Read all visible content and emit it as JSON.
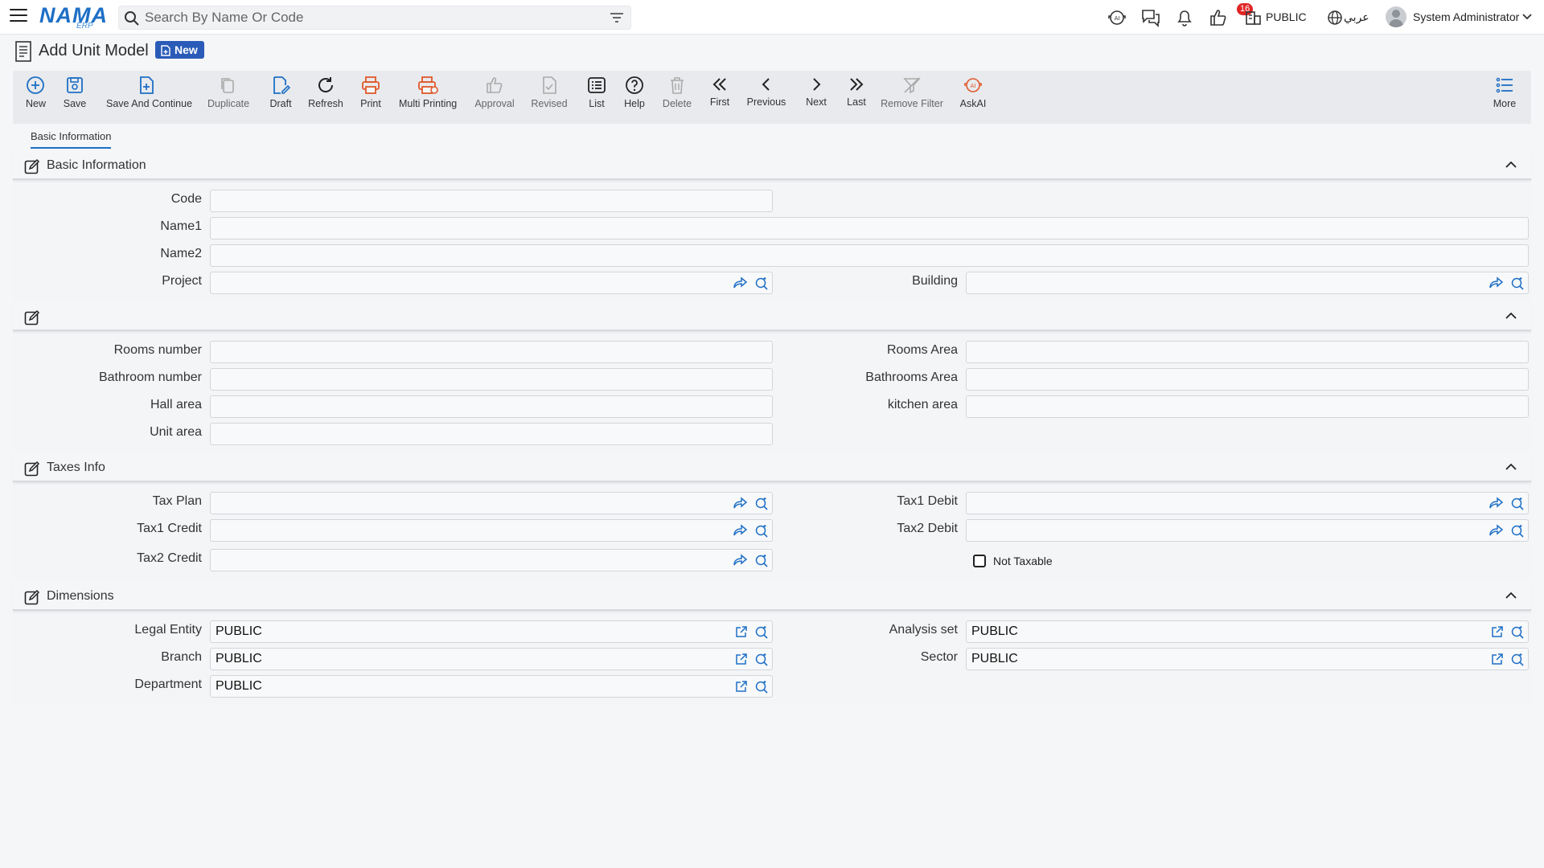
{
  "topbar": {
    "search_placeholder": "Search By Name Or Code",
    "logo_text": "NAMA",
    "logo_sub": "ERP",
    "notification_count": "16",
    "company": "PUBLIC",
    "language": "عربي",
    "user_name": "System Administrator"
  },
  "page": {
    "title": "Add Unit Model",
    "status_tag": "New"
  },
  "toolbar": {
    "new": "New",
    "save": "Save",
    "save_continue": "Save And Continue",
    "duplicate": "Duplicate",
    "draft": "Draft",
    "refresh": "Refresh",
    "print": "Print",
    "multi_printing": "Multi Printing",
    "approval": "Approval",
    "revised": "Revised",
    "list": "List",
    "help": "Help",
    "delete": "Delete",
    "first": "First",
    "previous": "Previous",
    "next": "Next",
    "last": "Last",
    "remove_filter": "Remove Filter",
    "askai": "AskAI",
    "more": "More"
  },
  "tabs": {
    "basic_information": "Basic Information"
  },
  "sections": {
    "basic": {
      "title": "Basic Information",
      "code_label": "Code",
      "code_value": "",
      "name1_label": "Name1",
      "name1_value": "",
      "name2_label": "Name2",
      "name2_value": "",
      "project_label": "Project",
      "project_value": "",
      "building_label": "Building",
      "building_value": ""
    },
    "areas": {
      "title": "",
      "rooms_number_label": "Rooms number",
      "rooms_area_label": "Rooms Area",
      "bathroom_number_label": "Bathroom number",
      "bathrooms_area_label": "Bathrooms Area",
      "hall_area_label": "Hall area",
      "kitchen_area_label": "kitchen area",
      "unit_area_label": "Unit area"
    },
    "taxes": {
      "title": "Taxes Info",
      "tax_plan_label": "Tax Plan",
      "tax1_debit_label": "Tax1 Debit",
      "tax1_credit_label": "Tax1 Credit",
      "tax2_debit_label": "Tax2 Debit",
      "tax2_credit_label": "Tax2 Credit",
      "not_taxable_label": "Not Taxable",
      "not_taxable_checked": false
    },
    "dimensions": {
      "title": "Dimensions",
      "legal_entity_label": "Legal Entity",
      "legal_entity_value": "PUBLIC",
      "analysis_set_label": "Analysis set",
      "analysis_set_value": "PUBLIC",
      "branch_label": "Branch",
      "branch_value": "PUBLIC",
      "sector_label": "Sector",
      "sector_value": "PUBLIC",
      "department_label": "Department",
      "department_value": "PUBLIC"
    }
  },
  "colors": {
    "accent": "#1e6fc6",
    "tag_bg": "#2a5bb8",
    "print_orange": "#e0582b",
    "badge_red": "#e02424"
  }
}
